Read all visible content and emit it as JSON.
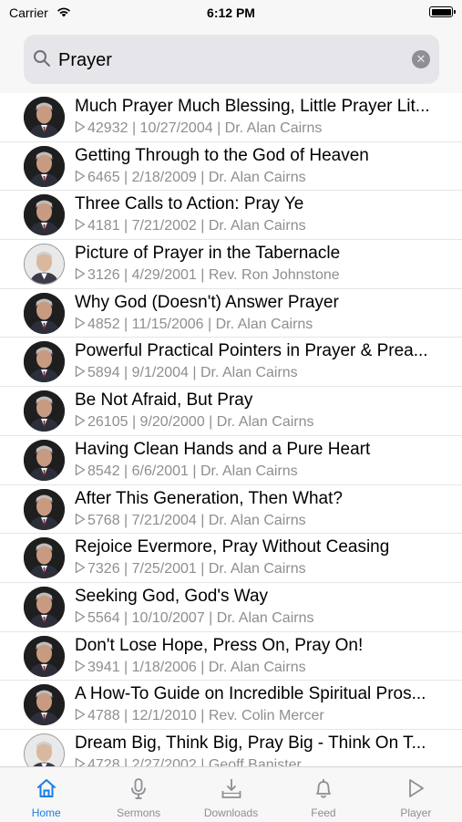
{
  "status": {
    "carrier": "Carrier",
    "time": "6:12 PM"
  },
  "search": {
    "value": "Prayer",
    "placeholder": "Search"
  },
  "sermons": [
    {
      "title": "Much Prayer Much Blessing, Little Prayer Lit...",
      "plays": "42932",
      "date": "10/27/2004",
      "speaker": "Dr. Alan Cairns",
      "avatar": "dark"
    },
    {
      "title": "Getting Through to the God of Heaven",
      "plays": "6465",
      "date": "2/18/2009",
      "speaker": "Dr. Alan Cairns",
      "avatar": "dark"
    },
    {
      "title": "Three Calls to Action: Pray Ye",
      "plays": "4181",
      "date": "7/21/2002",
      "speaker": "Dr. Alan Cairns",
      "avatar": "dark"
    },
    {
      "title": "Picture of Prayer in the Tabernacle",
      "plays": "3126",
      "date": "4/29/2001",
      "speaker": "Rev. Ron Johnstone",
      "avatar": "light"
    },
    {
      "title": "Why God (Doesn't) Answer Prayer",
      "plays": "4852",
      "date": "11/15/2006",
      "speaker": "Dr. Alan Cairns",
      "avatar": "dark"
    },
    {
      "title": "Powerful Practical Pointers in Prayer & Prea...",
      "plays": "5894",
      "date": "9/1/2004",
      "speaker": "Dr. Alan Cairns",
      "avatar": "dark"
    },
    {
      "title": "Be Not Afraid, But Pray",
      "plays": "26105",
      "date": "9/20/2000",
      "speaker": "Dr. Alan Cairns",
      "avatar": "dark"
    },
    {
      "title": "Having Clean Hands and a Pure Heart",
      "plays": "8542",
      "date": "6/6/2001",
      "speaker": "Dr. Alan Cairns",
      "avatar": "dark"
    },
    {
      "title": "After This Generation, Then What?",
      "plays": "5768",
      "date": "7/21/2004",
      "speaker": "Dr. Alan Cairns",
      "avatar": "dark"
    },
    {
      "title": "Rejoice Evermore, Pray Without Ceasing",
      "plays": "7326",
      "date": "7/25/2001",
      "speaker": "Dr. Alan Cairns",
      "avatar": "dark"
    },
    {
      "title": "Seeking God, God's Way",
      "plays": "5564",
      "date": "10/10/2007",
      "speaker": "Dr. Alan Cairns",
      "avatar": "dark"
    },
    {
      "title": "Don't Lose Hope, Press On, Pray On!",
      "plays": "3941",
      "date": "1/18/2006",
      "speaker": "Dr. Alan Cairns",
      "avatar": "dark"
    },
    {
      "title": "A How-To Guide on Incredible Spiritual Pros...",
      "plays": "4788",
      "date": "12/1/2010",
      "speaker": "Rev. Colin Mercer",
      "avatar": "dark"
    },
    {
      "title": "Dream Big, Think Big, Pray Big - Think On T...",
      "plays": "4728",
      "date": "2/27/2002",
      "speaker": "Geoff Banister",
      "avatar": "light"
    }
  ],
  "tabs": [
    {
      "label": "Home",
      "icon": "home-icon",
      "active": true
    },
    {
      "label": "Sermons",
      "icon": "microphone-icon",
      "active": false
    },
    {
      "label": "Downloads",
      "icon": "download-icon",
      "active": false
    },
    {
      "label": "Feed",
      "icon": "bell-icon",
      "active": false
    },
    {
      "label": "Player",
      "icon": "play-icon",
      "active": false
    }
  ],
  "colors": {
    "accent": "#1a7ee6",
    "secondary_text": "#8e8e93",
    "bar_bg": "#f7f7f7"
  }
}
